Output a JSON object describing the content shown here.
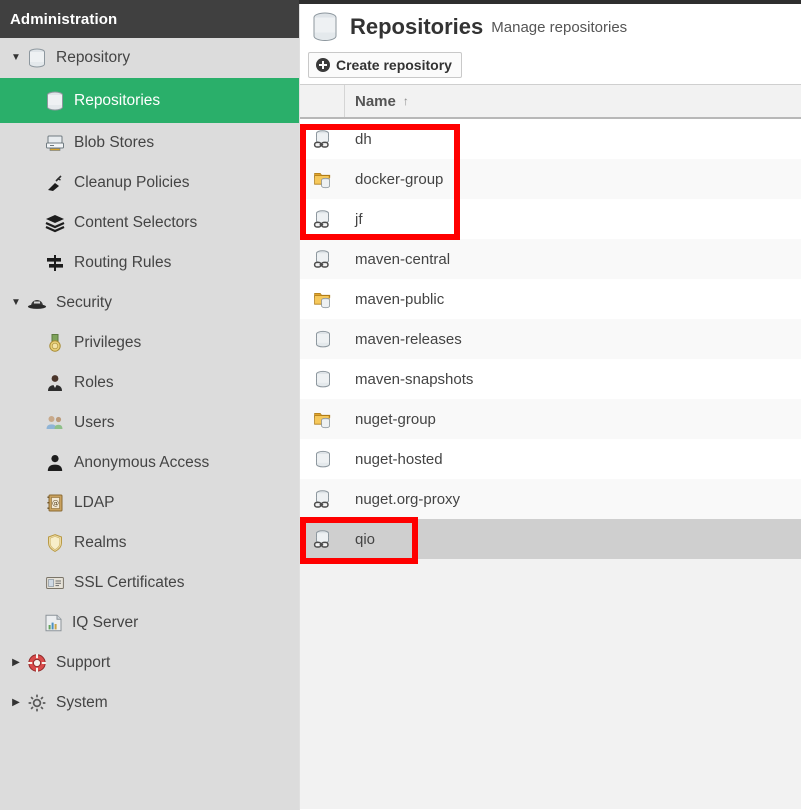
{
  "sidebar": {
    "header": "Administration",
    "items": [
      {
        "label": "Repository",
        "icon": "database-icon",
        "level": "group",
        "caret": "down",
        "selected": false
      },
      {
        "label": "Repositories",
        "icon": "database-icon",
        "level": "child",
        "caret": "none",
        "selected": true
      },
      {
        "label": "Blob Stores",
        "icon": "blob-store-icon",
        "level": "child",
        "caret": "none",
        "selected": false
      },
      {
        "label": "Cleanup Policies",
        "icon": "broom-icon",
        "level": "child",
        "caret": "none",
        "selected": false
      },
      {
        "label": "Content Selectors",
        "icon": "layers-icon",
        "level": "child",
        "caret": "none",
        "selected": false
      },
      {
        "label": "Routing Rules",
        "icon": "signpost-icon",
        "level": "child",
        "caret": "none",
        "selected": false
      },
      {
        "label": "Security",
        "icon": "security-hat-icon",
        "level": "group",
        "caret": "down",
        "selected": false
      },
      {
        "label": "Privileges",
        "icon": "medal-icon",
        "level": "child",
        "caret": "none",
        "selected": false
      },
      {
        "label": "Roles",
        "icon": "roles-person-icon",
        "level": "child",
        "caret": "none",
        "selected": false
      },
      {
        "label": "Users",
        "icon": "users-icon",
        "level": "child",
        "caret": "none",
        "selected": false
      },
      {
        "label": "Anonymous Access",
        "icon": "person-icon",
        "level": "child",
        "caret": "none",
        "selected": false
      },
      {
        "label": "LDAP",
        "icon": "address-book-icon",
        "level": "child",
        "caret": "none",
        "selected": false
      },
      {
        "label": "Realms",
        "icon": "shield-icon",
        "level": "child",
        "caret": "none",
        "selected": false
      },
      {
        "label": "SSL Certificates",
        "icon": "certificate-icon",
        "level": "child",
        "caret": "none",
        "selected": false
      },
      {
        "label": "IQ Server",
        "icon": "iq-server-icon",
        "level": "group2",
        "caret": "none",
        "selected": false
      },
      {
        "label": "Support",
        "icon": "lifebuoy-icon",
        "level": "group",
        "caret": "right",
        "selected": false
      },
      {
        "label": "System",
        "icon": "gear-icon",
        "level": "group",
        "caret": "right",
        "selected": false
      }
    ],
    "selected_color": "#2aaf6a"
  },
  "main": {
    "title": "Repositories",
    "subtitle": "Manage repositories",
    "title_icon": "database-icon",
    "create_button": {
      "label": "Create repository",
      "icon": "plus-circle-icon"
    },
    "table": {
      "columns": [
        {
          "key": "icon",
          "label": ""
        },
        {
          "key": "name",
          "label": "Name",
          "sort": "asc",
          "sort_glyph": "↑"
        }
      ],
      "rows": [
        {
          "name": "dh",
          "icon": "repo-proxy-icon",
          "selected": false
        },
        {
          "name": "docker-group",
          "icon": "repo-group-icon",
          "selected": false
        },
        {
          "name": "jf",
          "icon": "repo-proxy-icon",
          "selected": false
        },
        {
          "name": "maven-central",
          "icon": "repo-proxy-icon",
          "selected": false
        },
        {
          "name": "maven-public",
          "icon": "repo-group-icon",
          "selected": false
        },
        {
          "name": "maven-releases",
          "icon": "repo-hosted-icon",
          "selected": false
        },
        {
          "name": "maven-snapshots",
          "icon": "repo-hosted-icon",
          "selected": false
        },
        {
          "name": "nuget-group",
          "icon": "repo-group-icon",
          "selected": false
        },
        {
          "name": "nuget-hosted",
          "icon": "repo-hosted-icon",
          "selected": false
        },
        {
          "name": "nuget.org-proxy",
          "icon": "repo-proxy-icon",
          "selected": false
        },
        {
          "name": "qio",
          "icon": "repo-proxy-icon",
          "selected": true
        }
      ]
    }
  },
  "annotations": {
    "color": "#ff0000",
    "boxes": [
      {
        "name": "highlight-box-new-repos",
        "targets": [
          "dh",
          "docker-group",
          "jf"
        ]
      },
      {
        "name": "highlight-box-qio",
        "targets": [
          "qio"
        ]
      }
    ]
  }
}
